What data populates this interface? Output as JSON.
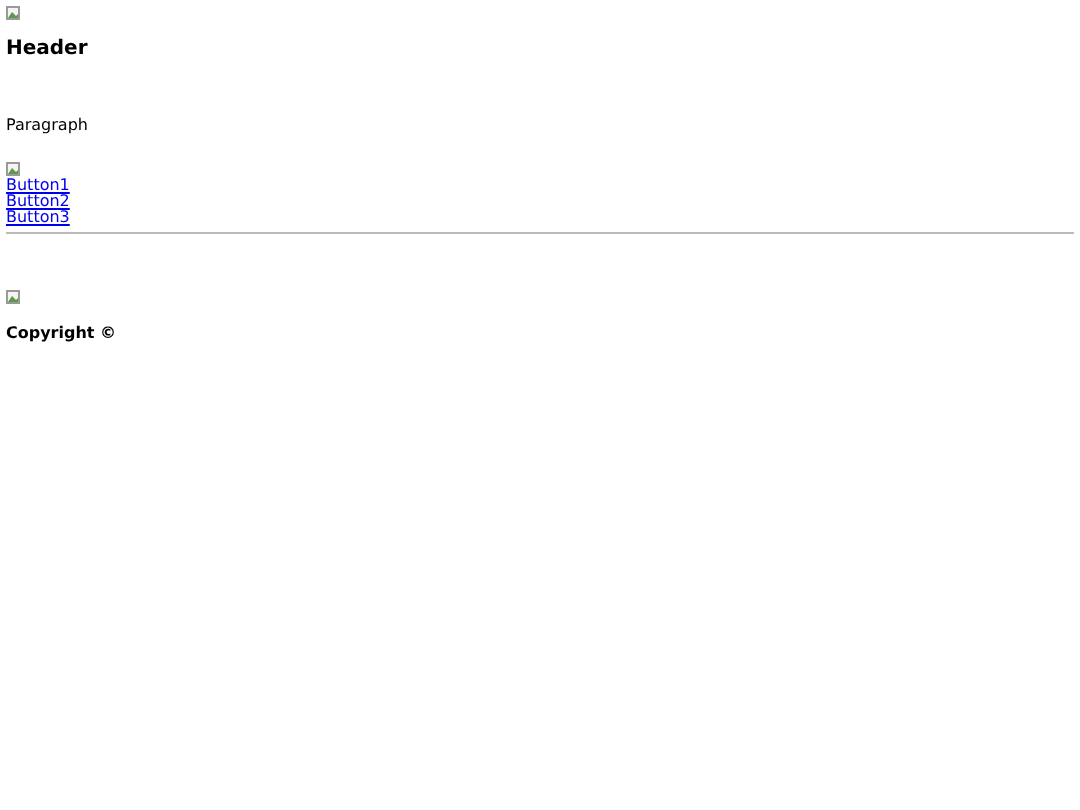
{
  "header": {
    "title": "Header"
  },
  "paragraph": "Paragraph",
  "links": [
    "Button1",
    "Button2",
    "Button3"
  ],
  "footer": {
    "copyright": "Copyright ©"
  }
}
